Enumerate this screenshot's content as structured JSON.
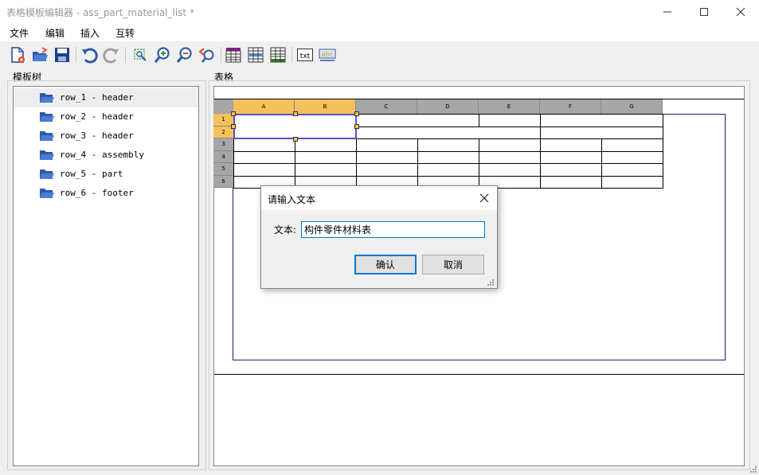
{
  "window": {
    "title": "表格模板编辑器 - ass_part_material_list *"
  },
  "menu": {
    "items": [
      {
        "label": "文件"
      },
      {
        "label": "编辑"
      },
      {
        "label": "插入"
      },
      {
        "label": "互转"
      }
    ]
  },
  "toolbar": {
    "buttons": [
      {
        "name": "new-file-icon"
      },
      {
        "name": "open-folder-icon"
      },
      {
        "name": "save-icon"
      },
      {
        "name": "undo-icon"
      },
      {
        "name": "redo-icon"
      },
      {
        "name": "zoom-fit-icon"
      },
      {
        "name": "zoom-in-icon"
      },
      {
        "name": "zoom-out-icon"
      },
      {
        "name": "zoom-reset-icon"
      },
      {
        "name": "table-style-purple-icon"
      },
      {
        "name": "table-style-blue-icon"
      },
      {
        "name": "table-style-green-icon"
      },
      {
        "name": "insert-text-icon",
        "label": "txt"
      },
      {
        "name": "insert-abc-icon",
        "label": "abc"
      }
    ]
  },
  "tree_panel": {
    "label": "模板树",
    "items": [
      {
        "label": "row_1 - header",
        "selected": true
      },
      {
        "label": "row_2 - header",
        "selected": false
      },
      {
        "label": "row_3 - header",
        "selected": false
      },
      {
        "label": "row_4 - assembly",
        "selected": false
      },
      {
        "label": "row_5 - part",
        "selected": false
      },
      {
        "label": "row_6 - footer",
        "selected": false
      }
    ]
  },
  "table_panel": {
    "label": "表格",
    "columns": [
      "A",
      "B",
      "C",
      "D",
      "E",
      "F",
      "G"
    ],
    "rows": [
      "1",
      "2",
      "3",
      "4",
      "5",
      "6"
    ],
    "selected_columns": [
      "A",
      "B"
    ],
    "selected_rows": [
      "1",
      "2"
    ]
  },
  "dialog": {
    "title": "请输入文本",
    "field_label": "文本:",
    "field_value": "构件零件材料表",
    "ok_label": "确认",
    "cancel_label": "取消"
  },
  "colors": {
    "header_gray": "#a6a6a6",
    "header_selected": "#f4c15a",
    "selection_border": "#5a4fcf",
    "frame_line": "#1a1a7a",
    "folder_blue": "#2f5aa8",
    "accent": "#0078d7"
  }
}
